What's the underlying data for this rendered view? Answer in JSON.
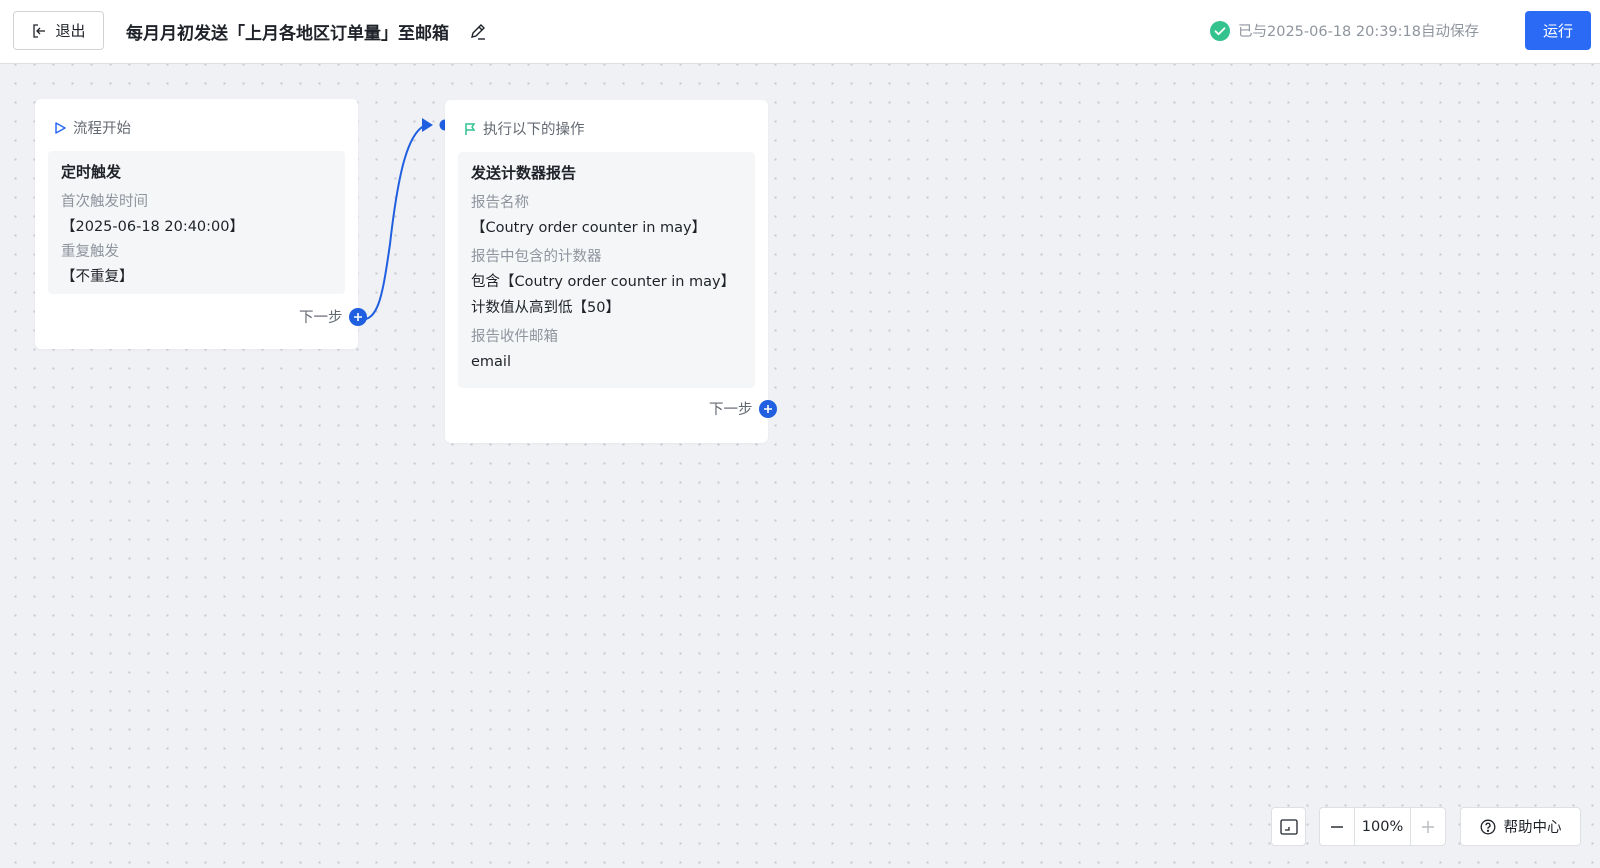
{
  "header": {
    "exit_label": "退出",
    "flow_title": "每月月初发送「上月各地区订单量」至邮箱",
    "save_status": "已与2025-06-18 20:39:18自动保存",
    "run_label": "运行"
  },
  "nodes": {
    "start": {
      "header": "流程开始",
      "title": "定时触发",
      "first_trigger_label": "首次触发时间",
      "first_trigger_value": "【2025-06-18 20:40:00】",
      "repeat_label": "重复触发",
      "repeat_value": "【不重复】",
      "next_label": "下一步"
    },
    "action": {
      "header": "执行以下的操作",
      "title": "发送计数器报告",
      "report_name_label": "报告名称",
      "report_name_value": "【Coutry order counter in may】",
      "counters_label": "报告中包含的计数器",
      "counters_value_1": "包含【Coutry order counter in may】",
      "counters_value_2": "计数值从高到低【50】",
      "recipient_label": "报告收件邮箱",
      "recipient_value": "email",
      "next_label": "下一步"
    }
  },
  "toolbar": {
    "zoom_value": "100%",
    "help_label": "帮助中心"
  },
  "colors": {
    "accent": "#2b6af5",
    "connector": "#1f5fe0",
    "success": "#34c38f"
  }
}
